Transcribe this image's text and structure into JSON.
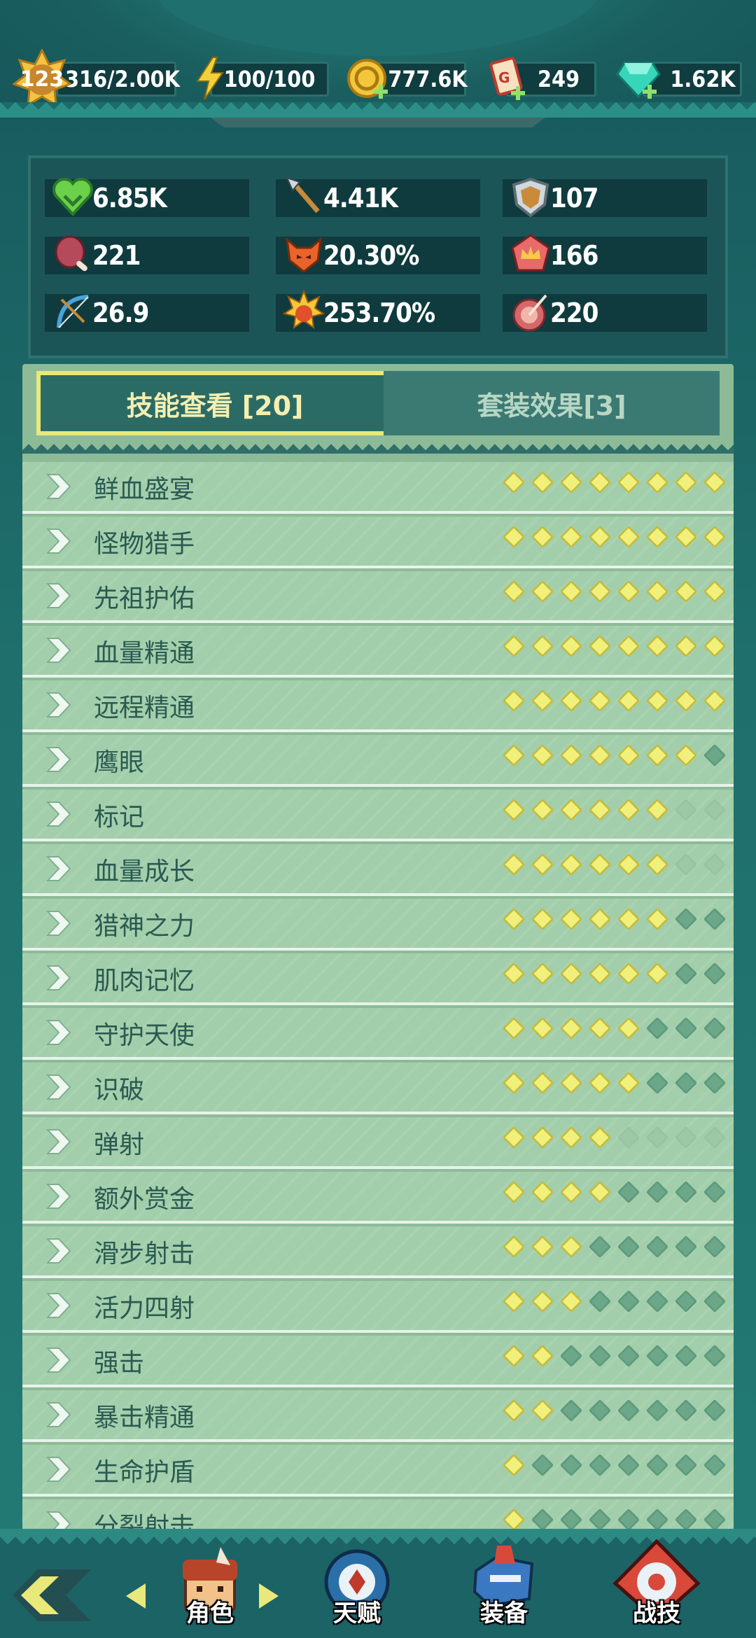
{
  "resources": {
    "level": "123",
    "xp": "316/2.00K",
    "energy": "100/100",
    "gold": "777.6K",
    "tickets": "249",
    "gems": "1.62K"
  },
  "stats": {
    "hp": "6.85K",
    "attack": "4.41K",
    "defense": "107",
    "meat": "221",
    "crit_rate": "20.30%",
    "crown": "166",
    "attack_speed": "26.9",
    "crit_damage": "253.70%",
    "target": "220"
  },
  "tabs": {
    "skills_label": "技能查看 [20]",
    "sets_label": "套装效果[3]"
  },
  "skills": [
    {
      "name": "鲜血盛宴",
      "filled": 8,
      "total": 8
    },
    {
      "name": "怪物猎手",
      "filled": 8,
      "total": 8
    },
    {
      "name": "先祖护佑",
      "filled": 8,
      "total": 8
    },
    {
      "name": "血量精通",
      "filled": 8,
      "total": 8
    },
    {
      "name": "远程精通",
      "filled": 8,
      "total": 8
    },
    {
      "name": "鹰眼",
      "filled": 7,
      "total": 8
    },
    {
      "name": "标记",
      "filled": 6,
      "total": 6
    },
    {
      "name": "血量成长",
      "filled": 6,
      "total": 6
    },
    {
      "name": "猎神之力",
      "filled": 6,
      "total": 8
    },
    {
      "name": "肌肉记忆",
      "filled": 6,
      "total": 8
    },
    {
      "name": "守护天使",
      "filled": 5,
      "total": 8
    },
    {
      "name": "识破",
      "filled": 5,
      "total": 8
    },
    {
      "name": "弹射",
      "filled": 4,
      "total": 4
    },
    {
      "name": "额外赏金",
      "filled": 4,
      "total": 8
    },
    {
      "name": "滑步射击",
      "filled": 3,
      "total": 8
    },
    {
      "name": "活力四射",
      "filled": 3,
      "total": 8
    },
    {
      "name": "强击",
      "filled": 2,
      "total": 8
    },
    {
      "name": "暴击精通",
      "filled": 2,
      "total": 8
    },
    {
      "name": "生命护盾",
      "filled": 1,
      "total": 8
    },
    {
      "name": "分裂射击",
      "filled": 1,
      "total": 8
    }
  ],
  "nav": {
    "character": "角色",
    "talent": "天赋",
    "equipment": "装备",
    "combat": "战技"
  }
}
